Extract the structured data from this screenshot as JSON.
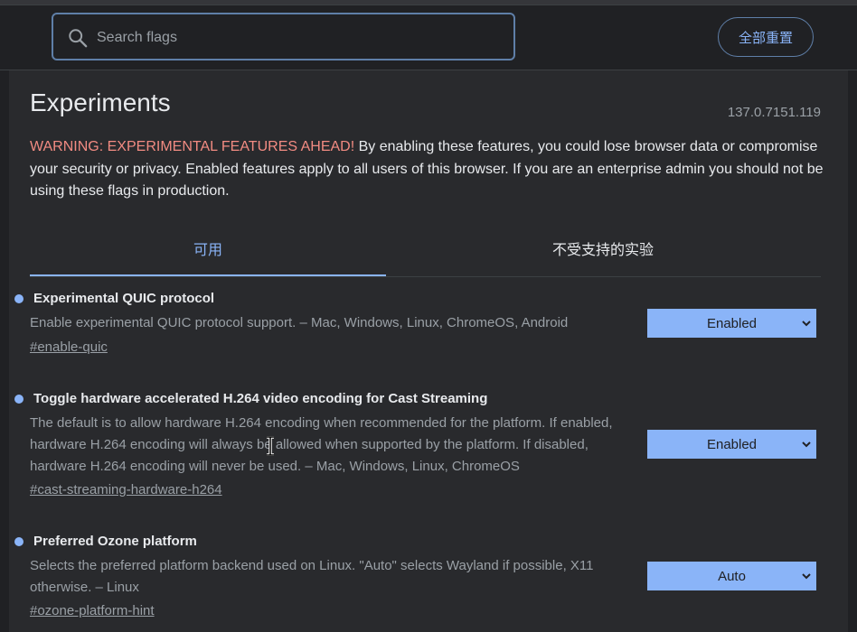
{
  "search": {
    "placeholder": "Search flags",
    "value": ""
  },
  "header": {
    "reset_all_label": "全部重置"
  },
  "page": {
    "title": "Experiments",
    "version": "137.0.7151.119",
    "warning_label": "WARNING: EXPERIMENTAL FEATURES AHEAD!",
    "warning_text": " By enabling these features, you could lose browser data or compromise your security or privacy. Enabled features apply to all users of this browser. If you are an enterprise admin you should not be using these flags in production."
  },
  "tabs": [
    {
      "label": "可用",
      "selected": true
    },
    {
      "label": "不受支持的实验",
      "selected": false
    }
  ],
  "flags": [
    {
      "name": "Experimental QUIC protocol",
      "description": "Enable experimental QUIC protocol support. – Mac, Windows, Linux, ChromeOS, Android",
      "link": "#enable-quic",
      "value": "Enabled"
    },
    {
      "name": "Toggle hardware accelerated H.264 video encoding for Cast Streaming",
      "description": "The default is to allow hardware H.264 encoding when recommended for the platform. If enabled, hardware H.264 encoding will always be allowed when supported by the platform. If disabled, hardware H.264 encoding will never be used. – Mac, Windows, Linux, ChromeOS",
      "link": "#cast-streaming-hardware-h264",
      "value": "Enabled"
    },
    {
      "name": "Preferred Ozone platform",
      "description": "Selects the preferred platform backend used on Linux. \"Auto\" selects Wayland if possible, X11 otherwise. – Linux",
      "link": "#ozone-platform-hint",
      "value": "Auto"
    }
  ],
  "colors": {
    "background": "#202124",
    "panel": "#292a2d",
    "accent": "#8ab4f8",
    "warning": "#f28b82",
    "secondary_text": "#9aa0a6"
  },
  "icons": [
    "search-icon",
    "chevron-down-icon",
    "text-cursor-icon",
    "flag-indicator-dot"
  ]
}
